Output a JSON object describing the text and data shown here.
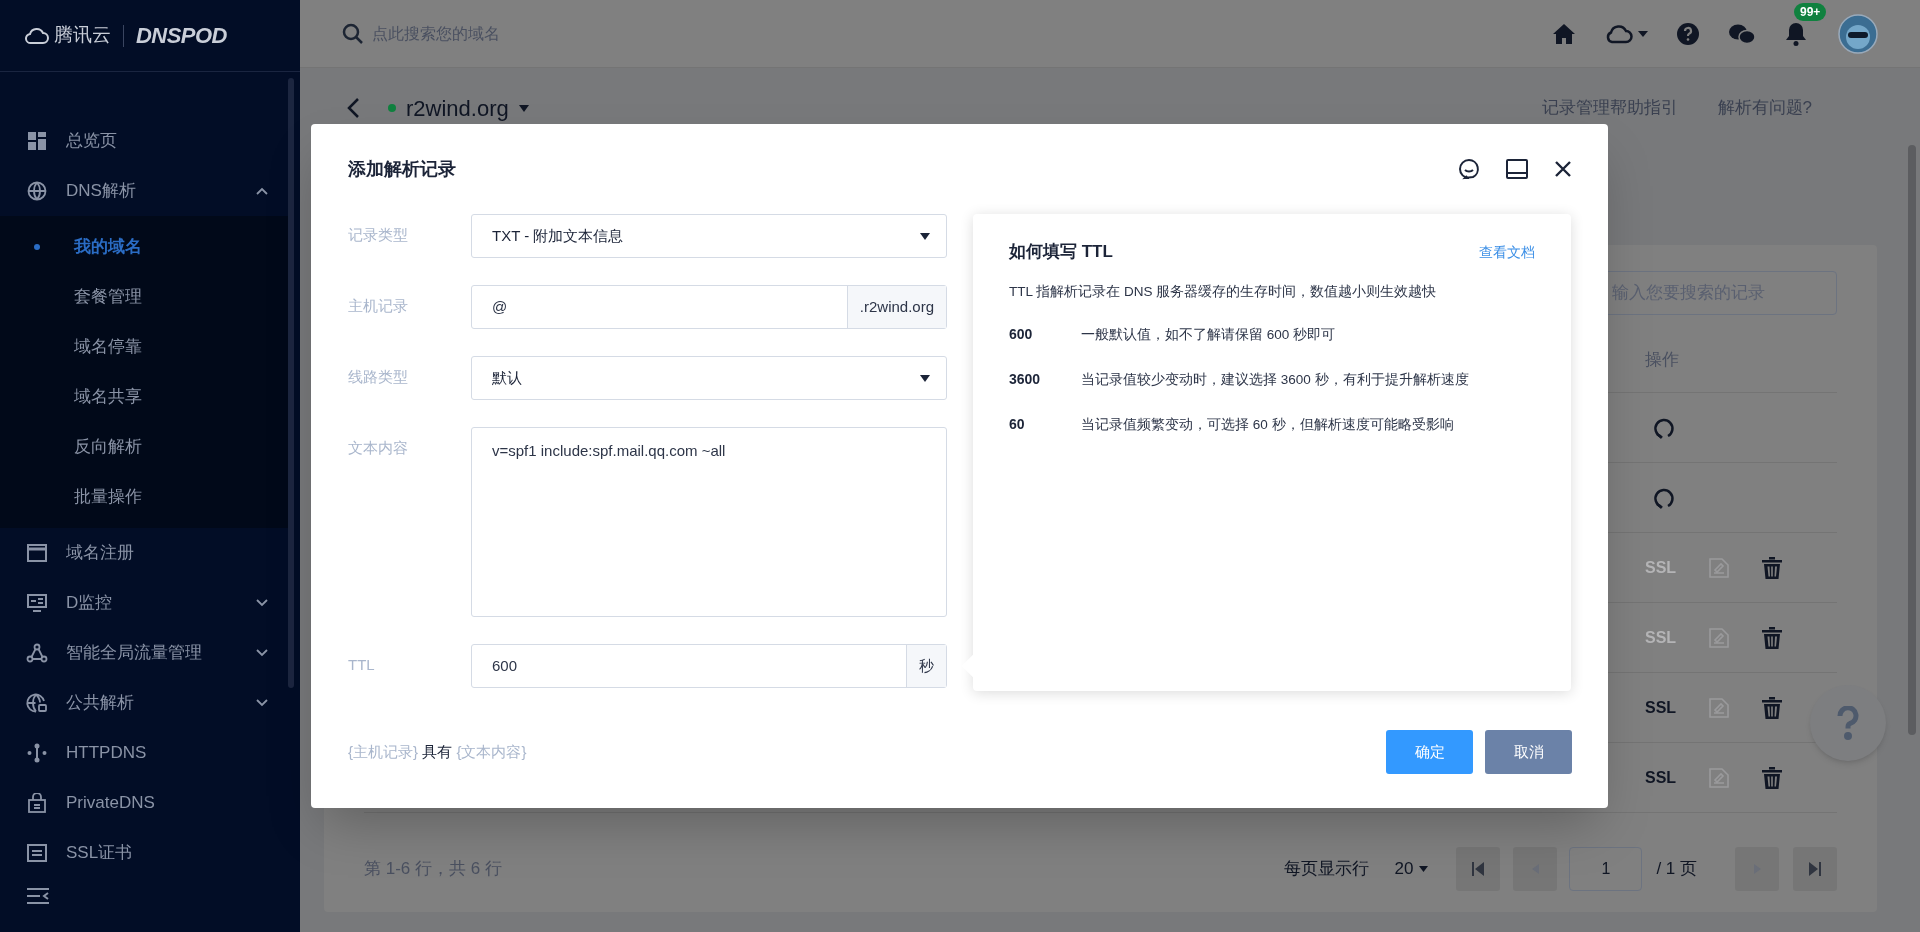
{
  "sidebar": {
    "logo_text": "腾讯云",
    "brand": "DNSPOD",
    "items": [
      {
        "kind": "link",
        "label": "总览页"
      },
      {
        "kind": "group",
        "label": "DNS解析",
        "expanded": true,
        "children": [
          {
            "label": "我的域名",
            "selected": true
          },
          {
            "label": "套餐管理",
            "selected": false
          },
          {
            "label": "域名停靠",
            "selected": false
          },
          {
            "label": "域名共享",
            "selected": false
          },
          {
            "label": "反向解析",
            "selected": false
          },
          {
            "label": "批量操作",
            "selected": false
          }
        ]
      },
      {
        "kind": "link",
        "label": "域名注册"
      },
      {
        "kind": "group",
        "label": "D监控",
        "expanded": false
      },
      {
        "kind": "group",
        "label": "智能全局流量管理",
        "expanded": false
      },
      {
        "kind": "group",
        "label": "公共解析",
        "expanded": false
      },
      {
        "kind": "link",
        "label": "HTTPDNS"
      },
      {
        "kind": "link",
        "label": "PrivateDNS"
      },
      {
        "kind": "link",
        "label": "SSL证书"
      }
    ]
  },
  "topbar": {
    "search_placeholder": "点此搜索您的域名",
    "notification_badge": "99+"
  },
  "page": {
    "domain": "r2wind.org",
    "domain_active": true,
    "links": [
      "记录管理帮助指引",
      "解析有问题?"
    ],
    "search_placeholder": "输入您要搜索的记录",
    "action_column": "操作",
    "rows": [
      {
        "kind": "paused"
      },
      {
        "kind": "paused"
      },
      {
        "kind": "actions",
        "ssl": "SSL",
        "ssl_disabled": true
      },
      {
        "kind": "actions",
        "ssl": "SSL",
        "ssl_disabled": true
      },
      {
        "kind": "actions",
        "ssl": "SSL",
        "ssl_disabled": false
      },
      {
        "kind": "actions",
        "ssl": "SSL",
        "ssl_disabled": false
      }
    ],
    "pagination": {
      "summary": "第 1-6 行，共 6 行",
      "page_size_label": "每页显示行",
      "page_size": "20",
      "page": "1",
      "total_pages": "/ 1 页"
    }
  },
  "dialog": {
    "title": "添加解析记录",
    "fields": [
      {
        "label": "记录类型",
        "kind": "select",
        "value": "TXT - 附加文本信息"
      },
      {
        "label": "主机记录",
        "kind": "input",
        "value": "@",
        "suffix": ".r2wind.org"
      },
      {
        "label": "线路类型",
        "kind": "select",
        "value": "默认"
      },
      {
        "label": "文本内容",
        "kind": "textarea",
        "value": "v=spf1 include:spf.mail.qq.com ~all"
      },
      {
        "label": "TTL",
        "kind": "input",
        "value": "600",
        "suffix": "秒"
      }
    ],
    "preview": [
      {
        "kind": "token",
        "text": "{主机记录}"
      },
      {
        "kind": "plain",
        "text": "具有"
      },
      {
        "kind": "token",
        "text": "{文本内容}"
      }
    ],
    "help": {
      "title": "如何填写 TTL",
      "link": "查看文档",
      "intro": "TTL 指解析记录在 DNS 服务器缓存的生存时间，数值越小则生效越快",
      "entries": [
        {
          "value": "600",
          "text": "一般默认值，如不了解请保留 600 秒即可"
        },
        {
          "value": "3600",
          "text": "当记录值较少变动时，建议选择 3600 秒，有利于提升解析速度"
        },
        {
          "value": "60",
          "text": "当记录值频繁变动，可选择 60 秒，但解析速度可能略受影响"
        }
      ]
    },
    "buttons": [
      {
        "kind": "primary",
        "label": "确定"
      },
      {
        "kind": "secondary",
        "label": "取消"
      }
    ]
  }
}
